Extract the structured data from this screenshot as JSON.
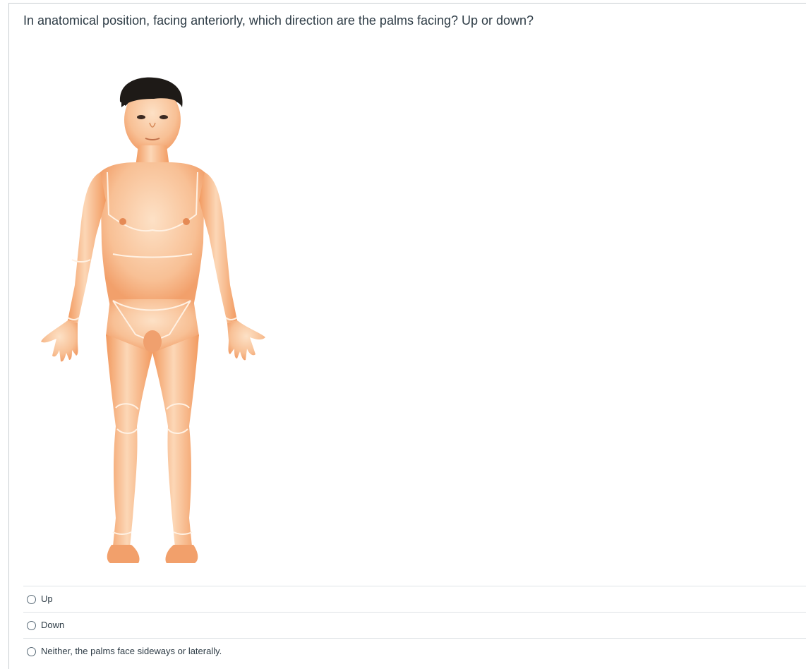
{
  "question": {
    "text": "In anatomical position, facing anteriorly, which direction are the palms facing? Up or down?"
  },
  "figure": {
    "icon": "anatomical-position-figure"
  },
  "answers": [
    {
      "label": "Up",
      "selected": false
    },
    {
      "label": "Down",
      "selected": false
    },
    {
      "label": "Neither, the palms face sideways or laterally.",
      "selected": false
    }
  ],
  "colors": {
    "text": "#2d3b45",
    "border": "#c7cdd1",
    "divider": "#dfe3e6",
    "skin": "#f7b98a"
  }
}
